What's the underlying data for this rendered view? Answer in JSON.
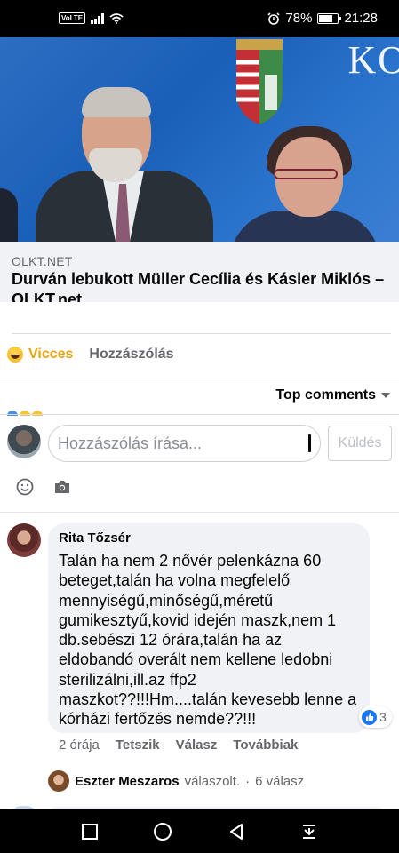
{
  "status_bar": {
    "carrier_badge": "VoLTE",
    "battery_percent": "78%",
    "battery_level": 0.78,
    "time": "21:28"
  },
  "hero": {
    "background_text": "KO"
  },
  "link_preview": {
    "domain": "OLKT.NET",
    "title": "Durván lebukott Müller Cecília és Kásler Miklós – OLKT.net"
  },
  "actions": {
    "reaction_label": "Vicces",
    "comment_label": "Hozzászólás"
  },
  "sort": {
    "label": "Top comments"
  },
  "composer": {
    "placeholder": "Hozzászólás írása...",
    "send_label": "Küldés"
  },
  "comment": {
    "author": "Rita Tőzsér",
    "text": "Talán ha nem 2 nővér pelenkázna 60 beteget,talán ha volna megfelelő mennyiségű,minőségű,méretű gumikesztyű,kovid idején maszk,nem 1 db.sebészi 12 órára,talán ha az eldobandó overált nem kellene ledobni sterilizálni,ill.az ffp2 maszkot??!!!Hm....talán kevesebb lenne a kórházi fertőzés nemde??!!!",
    "reaction_count": "3",
    "time": "2 órája",
    "like_label": "Tetszik",
    "reply_label": "Válasz",
    "more_label": "Továbbiak"
  },
  "reply_summary": {
    "author": "Eszter Meszaros",
    "action": "válaszolt.",
    "separator": "·",
    "count": "6 válasz"
  },
  "colors": {
    "accent": "#1877f2",
    "haha": "#e8a30d",
    "muted": "#65676b"
  }
}
